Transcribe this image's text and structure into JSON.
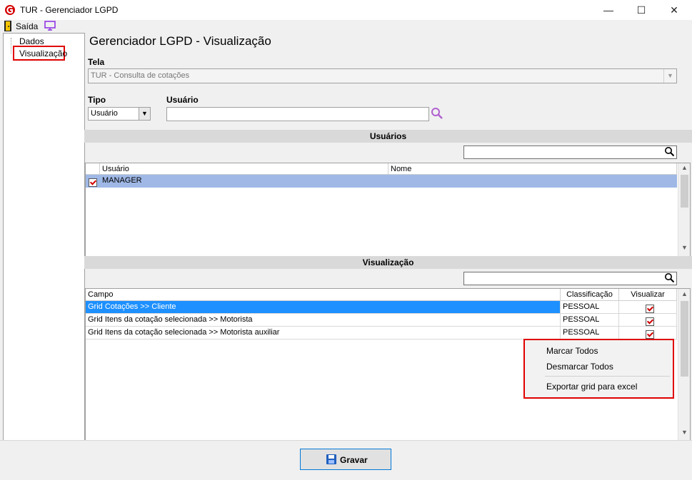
{
  "window": {
    "title": "TUR - Gerenciador LGPD",
    "minimize": "—",
    "maximize": "☐",
    "close": "✕"
  },
  "toolbar": {
    "exit_label": "Saída"
  },
  "tree": {
    "items": [
      {
        "label": "Dados"
      },
      {
        "label": "Visualização"
      }
    ]
  },
  "page": {
    "title": "Gerenciador LGPD - Visualização"
  },
  "tela": {
    "label": "Tela",
    "value": "TUR - Consulta de cotações"
  },
  "tipo": {
    "label": "Tipo",
    "value": "Usuário"
  },
  "usuario": {
    "label": "Usuário",
    "value": ""
  },
  "users_section": {
    "title": "Usuários",
    "search_value": "",
    "columns": [
      "Usuário",
      "Nome"
    ],
    "rows": [
      {
        "checked": true,
        "usuario": "MANAGER",
        "nome": ""
      }
    ]
  },
  "view_section": {
    "title": "Visualização",
    "search_value": "",
    "columns": [
      "Campo",
      "Classificação",
      "Visualizar"
    ],
    "rows": [
      {
        "campo": "Grid Cotações >> Cliente",
        "classificacao": "PESSOAL",
        "visualizar": true
      },
      {
        "campo": "Grid Itens da cotação selecionada >> Motorista",
        "classificacao": "PESSOAL",
        "visualizar": true
      },
      {
        "campo": "Grid Itens da cotação selecionada >> Motorista auxiliar",
        "classificacao": "PESSOAL",
        "visualizar": true
      }
    ]
  },
  "context_menu": {
    "items": [
      "Marcar Todos",
      "Desmarcar Todos",
      "Exportar grid para excel"
    ]
  },
  "footer": {
    "save_label": "Gravar"
  },
  "colors": {
    "accent_red": "#e00000",
    "selection": "#1e90ff",
    "section_header": "#d9d9d9"
  }
}
